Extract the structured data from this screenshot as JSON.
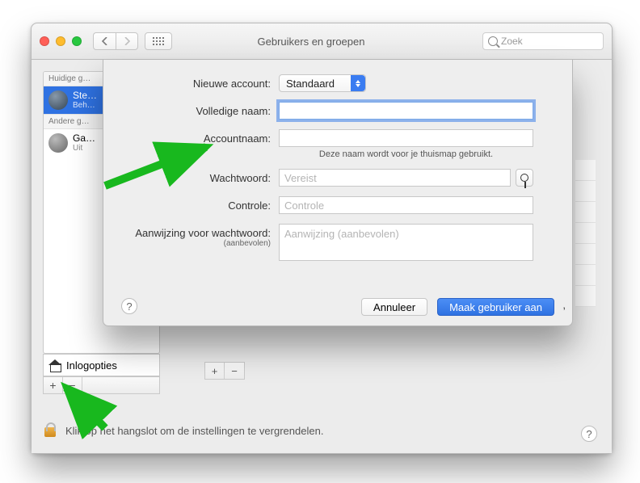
{
  "toolbar": {
    "back_icon": "chevron-left",
    "fwd_icon": "chevron-right",
    "title": "Gebruikers en groepen",
    "search_placeholder": "Zoek"
  },
  "sidebar": {
    "section_current": "Huidige g…",
    "current_user": {
      "name": "Ste…",
      "role": "Beh…"
    },
    "section_other": "Andere g…",
    "other_user": {
      "name": "Ga…",
      "role": "Uit"
    },
    "login_options": "Inlogopties",
    "plus": "+",
    "minus": "−"
  },
  "detail": {
    "plus": "+",
    "minus": "−"
  },
  "lock": {
    "text": "Klik op het hangslot om de instellingen te vergrendelen.",
    "help": "?"
  },
  "sheet": {
    "labels": {
      "account": "Nieuwe account:",
      "fullname": "Volledige naam:",
      "acctname": "Accountnaam:",
      "acctname_hint": "Deze naam wordt voor je thuismap gebruikt.",
      "password": "Wachtwoord:",
      "verify": "Controle:",
      "hint": "Aanwijzing voor wachtwoord:",
      "hint_sub": "(aanbevolen)"
    },
    "values": {
      "account_type": "Standaard",
      "fullname": "",
      "acctname": "",
      "password_placeholder": "Vereist",
      "verify_placeholder": "Controle",
      "hint_placeholder": "Aanwijzing (aanbevolen)"
    },
    "buttons": {
      "cancel": "Annuleer",
      "create": "Maak gebruiker aan"
    },
    "help": "?"
  }
}
